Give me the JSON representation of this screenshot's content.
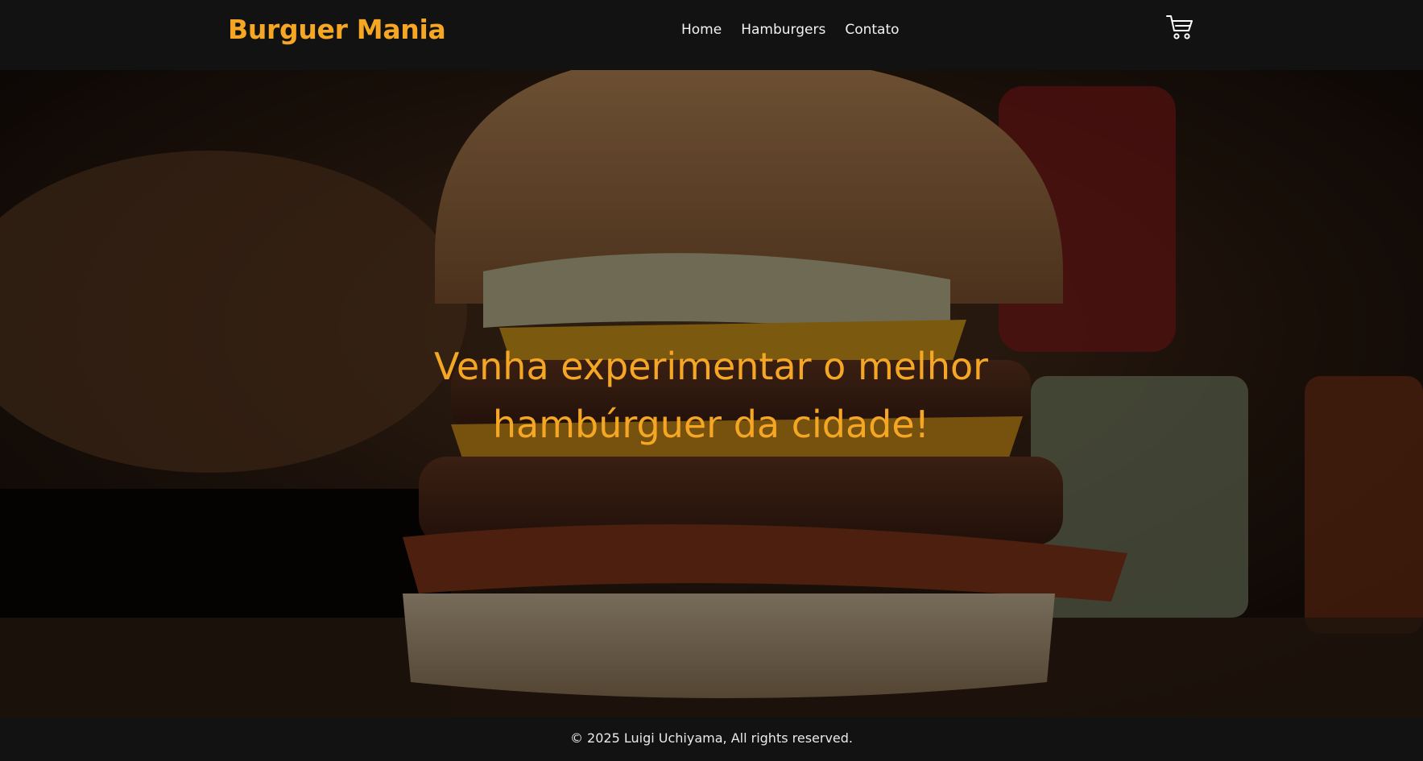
{
  "header": {
    "brand": "Burguer Mania",
    "nav": [
      {
        "label": "Home"
      },
      {
        "label": "Hamburgers"
      },
      {
        "label": "Contato"
      }
    ],
    "cart_icon": "shopping-cart-icon"
  },
  "hero": {
    "headline_line1": "Venha experimentar o melhor",
    "headline_line2": "hambúrguer da cidade!",
    "image_subject": "stacked bacon cheeseburger"
  },
  "footer": {
    "text": "© 2025 Luigi Uchiyama, All rights reserved."
  },
  "colors": {
    "accent": "#f5a623",
    "background": "#121212",
    "text": "#f2f2f2"
  }
}
